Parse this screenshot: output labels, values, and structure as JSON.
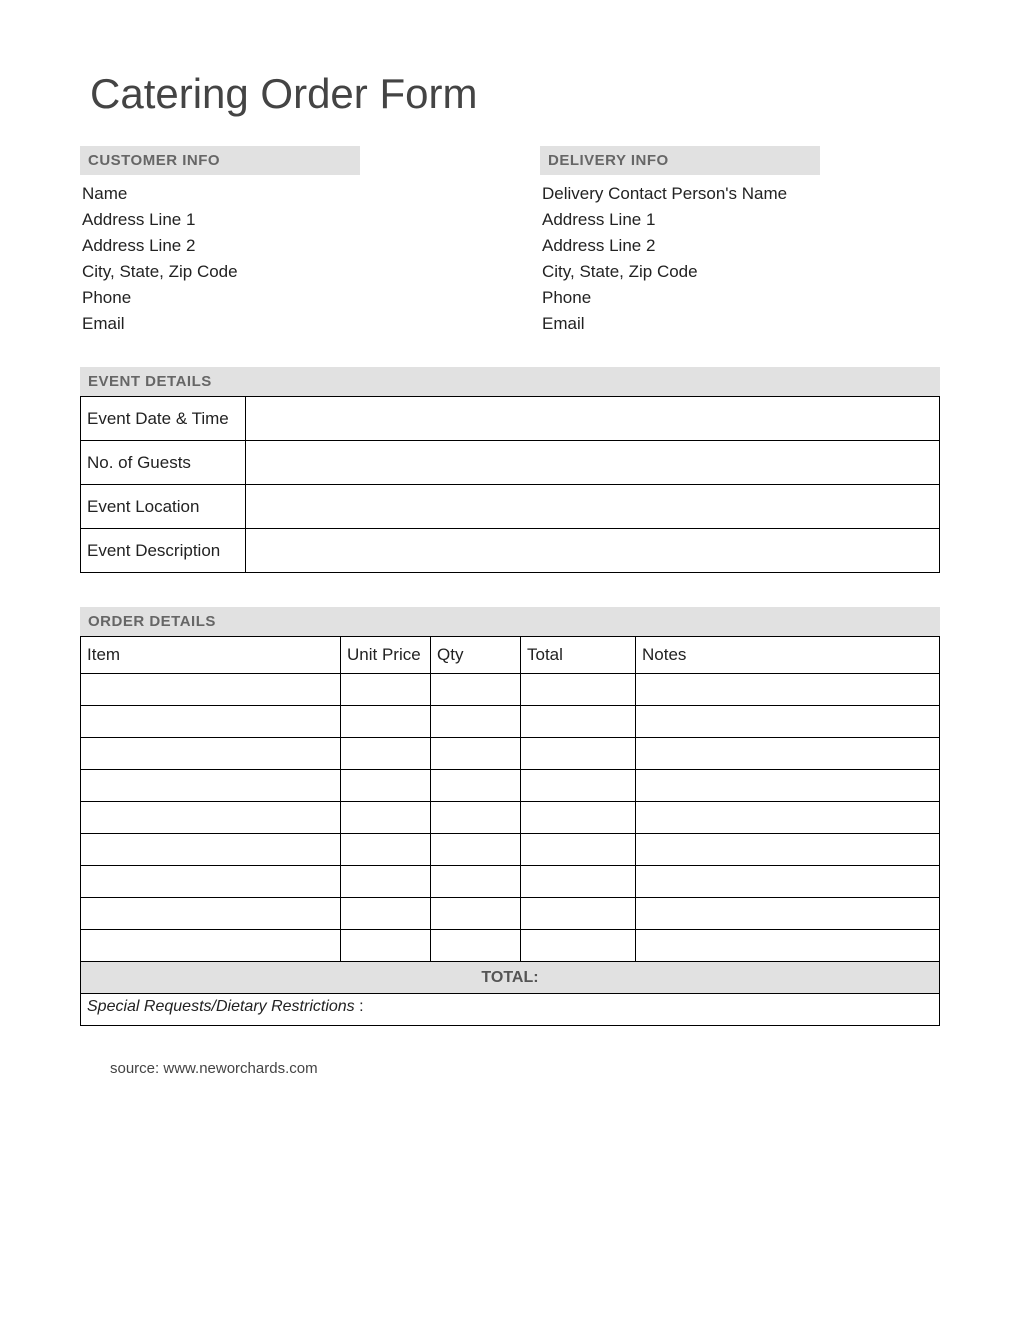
{
  "title": "Catering Order Form",
  "customerInfo": {
    "header": "CUSTOMER INFO",
    "fields": [
      "Name",
      "Address Line 1",
      "Address Line 2",
      "City, State, Zip Code",
      "Phone",
      "Email"
    ]
  },
  "deliveryInfo": {
    "header": "DELIVERY INFO",
    "fields": [
      "Delivery Contact Person's Name",
      "Address Line 1",
      "Address Line 2",
      "City, State, Zip Code",
      "Phone",
      "Email"
    ]
  },
  "eventDetails": {
    "header": "EVENT DETAILS",
    "rows": [
      {
        "label": "Event Date & Time",
        "value": ""
      },
      {
        "label": "No. of Guests",
        "value": ""
      },
      {
        "label": "Event Location",
        "value": ""
      },
      {
        "label": "Event Description",
        "value": ""
      }
    ]
  },
  "orderDetails": {
    "header": "ORDER DETAILS",
    "columns": [
      "Item",
      "Unit Price",
      "Qty",
      "Total",
      "Notes"
    ],
    "rows": [
      {
        "item": "",
        "unitPrice": "",
        "qty": "",
        "total": "",
        "notes": ""
      },
      {
        "item": "",
        "unitPrice": "",
        "qty": "",
        "total": "",
        "notes": ""
      },
      {
        "item": "",
        "unitPrice": "",
        "qty": "",
        "total": "",
        "notes": ""
      },
      {
        "item": "",
        "unitPrice": "",
        "qty": "",
        "total": "",
        "notes": ""
      },
      {
        "item": "",
        "unitPrice": "",
        "qty": "",
        "total": "",
        "notes": ""
      },
      {
        "item": "",
        "unitPrice": "",
        "qty": "",
        "total": "",
        "notes": ""
      },
      {
        "item": "",
        "unitPrice": "",
        "qty": "",
        "total": "",
        "notes": ""
      },
      {
        "item": "",
        "unitPrice": "",
        "qty": "",
        "total": "",
        "notes": ""
      },
      {
        "item": "",
        "unitPrice": "",
        "qty": "",
        "total": "",
        "notes": ""
      }
    ],
    "totalLabel": "TOTAL:",
    "specialLabel": "Special Requests/Dietary Restrictions",
    "specialSuffix": " :"
  },
  "source": "source: www.neworchards.com"
}
